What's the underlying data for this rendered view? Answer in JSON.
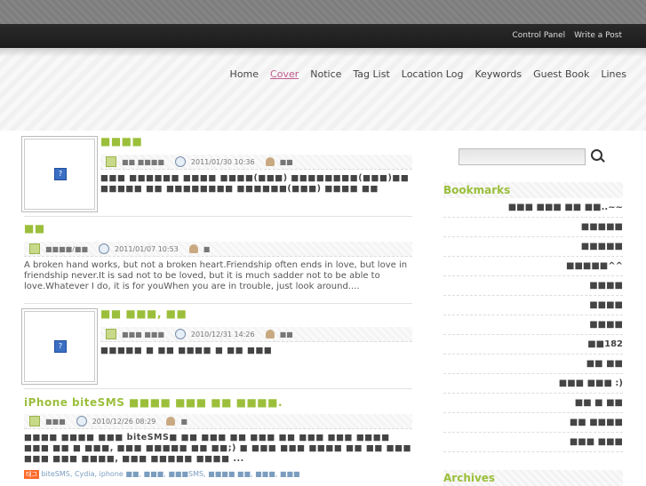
{
  "topbar": {
    "links": [
      "Control Panel",
      "Write a Post"
    ]
  },
  "nav": {
    "items": [
      "Home",
      "Cover",
      "Notice",
      "Tag List",
      "Location Log",
      "Keywords",
      "Guest Book",
      "Lines"
    ],
    "active_index": 1
  },
  "posts": [
    {
      "title": "■■■■",
      "category": "■■ ■■■■",
      "date": "2011/01/30 10:36",
      "author": "■■",
      "excerpt": "■■■ ■■■■■■ ■■■■ ■■■■(■■■) ■■■■■■■■(■■■)■■ ■■■■■ ■■ ■■■■■■■■ ■■■■■■(■■■) ■■■■ ■■"
    },
    {
      "title": "■■",
      "category": "■■■■/■■",
      "date": "2011/01/07 10:53",
      "author": "■",
      "excerpt": "A broken hand works, but not a broken heart.Friendship often ends in love, but love in friendship never.It is sad not to be loved, but it is much sadder not to be able to love.Whatever I do, it is for youWhen you are in trouble, just look around...."
    },
    {
      "title": "■■ ■■■, ■■",
      "category": "■■■ ■■■",
      "date": "2010/12/31 14:26",
      "author": "■■",
      "excerpt": "■■■■■ ■ ■■ ■■■■ ■ ■■ ■■■"
    },
    {
      "title": "iPhone biteSMS ■■■■ ■■■ ■■ ■■■■.",
      "category": "■■■",
      "date": "2010/12/26 08:29",
      "author": "■",
      "excerpt": "■■■■ ■■■■ ■■■ biteSMS■ ■■ ■■■ ■■ ■■■ ■■ ■■■ ■■■ ■■■■ ■■■ ■■ ■ ■■■, ■■■ ■■■■■ ■■ ■■;) ■ ■■■ ■■■ ■■■■ ■■ ■■ ■■■ ■■■ ■■■ ■■■■, ■■■ ■■■■■ ■■■■ ...",
      "tag_icon": "태그",
      "tags": "biteSMS, Cydia, iphone ■■, ■■■, ■■■SMS, ■■■■ ■■, ■■■, ■■■"
    }
  ],
  "sidebar": {
    "bookmarks_title": "Bookmarks",
    "bookmarks": [
      "■■■ ■■■ ■■ ■■..~~",
      "■■■■■",
      "■■■■■",
      "■■■■■^^",
      "■■■■",
      "■■■■",
      "■■■■",
      "■■182",
      "■■ ■■",
      "■■■ ■■■ :)",
      "■■ ■ ■■",
      "■■ ■■■■",
      "■■■ ■■■"
    ],
    "archives_title": "Archives"
  },
  "colors": {
    "accent": "#9bbf3b",
    "link_active": "#c25c8c",
    "topbar": "#1e1e1e"
  }
}
